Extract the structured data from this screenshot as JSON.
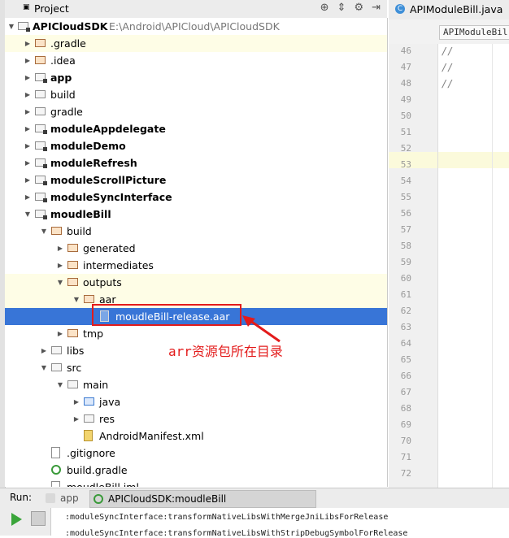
{
  "project_panel": {
    "title": "Project",
    "icons": [
      "target-icon",
      "collapse-icon",
      "gear-icon",
      "hide-icon"
    ]
  },
  "tree": {
    "root": {
      "name": "APICloudSDK",
      "path": "E:\\Android\\APICloud\\APICloudSDK"
    },
    "items": [
      {
        "label": ".gradle",
        "indent": 1
      },
      {
        "label": ".idea",
        "indent": 1
      },
      {
        "label": "app",
        "indent": 1
      },
      {
        "label": "build",
        "indent": 1
      },
      {
        "label": "gradle",
        "indent": 1
      },
      {
        "label": "moduleAppdelegate",
        "indent": 1
      },
      {
        "label": "moduleDemo",
        "indent": 1
      },
      {
        "label": "moduleRefresh",
        "indent": 1
      },
      {
        "label": "moduleScrollPicture",
        "indent": 1
      },
      {
        "label": "moduleSyncInterface",
        "indent": 1
      },
      {
        "label": "moudleBill",
        "indent": 1
      },
      {
        "label": "build",
        "indent": 2
      },
      {
        "label": "generated",
        "indent": 3
      },
      {
        "label": "intermediates",
        "indent": 3
      },
      {
        "label": "outputs",
        "indent": 3
      },
      {
        "label": "aar",
        "indent": 4
      },
      {
        "label": "moudleBill-release.aar",
        "indent": 5
      },
      {
        "label": "tmp",
        "indent": 3
      },
      {
        "label": "libs",
        "indent": 2
      },
      {
        "label": "src",
        "indent": 2
      },
      {
        "label": "main",
        "indent": 3
      },
      {
        "label": "java",
        "indent": 4
      },
      {
        "label": "res",
        "indent": 4
      },
      {
        "label": "AndroidManifest.xml",
        "indent": 4
      },
      {
        "label": ".gitignore",
        "indent": 2
      },
      {
        "label": "build.gradle",
        "indent": 2
      },
      {
        "label": "moudleBill.iml",
        "indent": 2
      }
    ]
  },
  "annotation": {
    "text": "arr资源包所在目录",
    "color": "#e31b1b"
  },
  "editor": {
    "tab_label": "APIModuleBill.java",
    "breadcrumb": "APIModuleBil",
    "lines": [
      {
        "num": "46",
        "code": "//"
      },
      {
        "num": "47",
        "code": "//"
      },
      {
        "num": "48",
        "code": "//"
      },
      {
        "num": "49",
        "code": ""
      },
      {
        "num": "50",
        "code": ""
      },
      {
        "num": "51",
        "code": ""
      },
      {
        "num": "52",
        "code": ""
      },
      {
        "num": "53",
        "code": ""
      },
      {
        "num": "54",
        "code": ""
      },
      {
        "num": "55",
        "code": ""
      },
      {
        "num": "56",
        "code": ""
      },
      {
        "num": "57",
        "code": ""
      },
      {
        "num": "58",
        "code": ""
      },
      {
        "num": "59",
        "code": ""
      },
      {
        "num": "60",
        "code": ""
      },
      {
        "num": "61",
        "code": ""
      },
      {
        "num": "62",
        "code": ""
      },
      {
        "num": "63",
        "code": ""
      },
      {
        "num": "64",
        "code": ""
      },
      {
        "num": "65",
        "code": ""
      },
      {
        "num": "66",
        "code": ""
      },
      {
        "num": "67",
        "code": ""
      },
      {
        "num": "68",
        "code": ""
      },
      {
        "num": "69",
        "code": ""
      },
      {
        "num": "70",
        "code": ""
      },
      {
        "num": "71",
        "code": ""
      },
      {
        "num": "72",
        "code": ""
      }
    ]
  },
  "run_bar": {
    "label": "Run:",
    "tabs": [
      "app",
      "APICloudSDK:moudleBill [assembleRelease]"
    ]
  },
  "console": {
    "lines": [
      ":moduleSyncInterface:transformNativeLibsWithMergeJniLibsForRelease",
      ":moduleSyncInterface:transformNativeLibsWithStripDebugSymbolForRelease"
    ]
  },
  "colors": {
    "selection": "#3875d7",
    "highlight": "#fefde6",
    "annotation": "#e31b1b"
  }
}
